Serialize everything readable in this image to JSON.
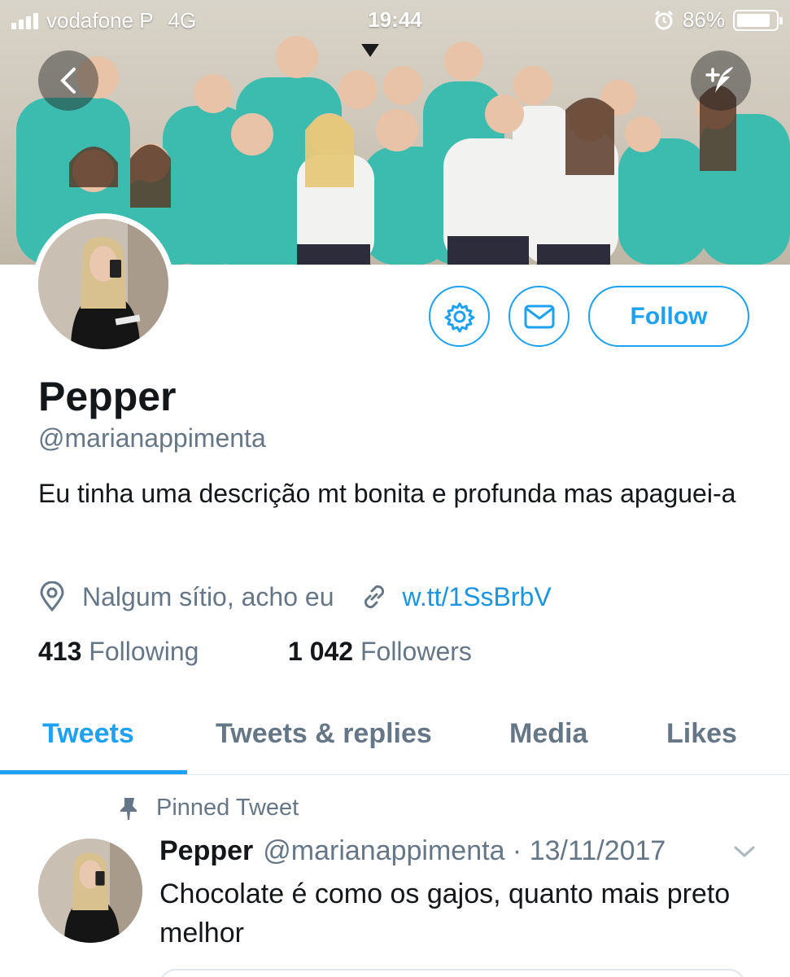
{
  "status_bar": {
    "carrier": "vodafone P",
    "network": "4G",
    "time": "19:44",
    "battery": "86%",
    "battery_level": 0.86
  },
  "profile": {
    "display_name": "Pepper",
    "handle": "@marianappimenta",
    "bio": "Eu tinha uma descrição mt bonita e profunda mas apaguei-a",
    "location": "Nalgum sítio, acho eu",
    "link": "w.tt/1SsBrbV",
    "following_count": "413",
    "following_label": "Following",
    "followers_count": "1 042",
    "followers_label": "Followers"
  },
  "actions": {
    "follow_label": "Follow",
    "settings_icon": "gear-icon",
    "message_icon": "envelope-icon"
  },
  "tabs": [
    {
      "label": "Tweets",
      "active": true
    },
    {
      "label": "Tweets & replies",
      "active": false
    },
    {
      "label": "Media",
      "active": false
    },
    {
      "label": "Likes",
      "active": false
    }
  ],
  "pinned_tweet": {
    "pinned_label": "Pinned Tweet",
    "author_name": "Pepper",
    "author_handle": "@marianappimenta",
    "date": "13/11/2017",
    "text": "Chocolate é como os gajos, quanto mais preto melhor"
  },
  "colors": {
    "accent": "#1da1f2",
    "link": "#1b95e0",
    "secondary_text": "#657786",
    "hoodie_teal": "#3fbfb0"
  }
}
